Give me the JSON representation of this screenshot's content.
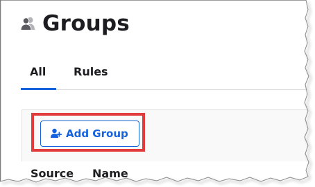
{
  "header": {
    "title": "Groups",
    "icon": "users-group-icon"
  },
  "tabs": [
    {
      "label": "All",
      "active": true
    },
    {
      "label": "Rules",
      "active": false
    }
  ],
  "toolbar": {
    "add_group_label": "Add Group",
    "add_group_icon": "add-user-icon"
  },
  "table": {
    "columns": [
      "Source",
      "Name"
    ]
  },
  "colors": {
    "accent": "#1662dd",
    "highlight": "#e23b3b",
    "text": "#1d1d21"
  }
}
